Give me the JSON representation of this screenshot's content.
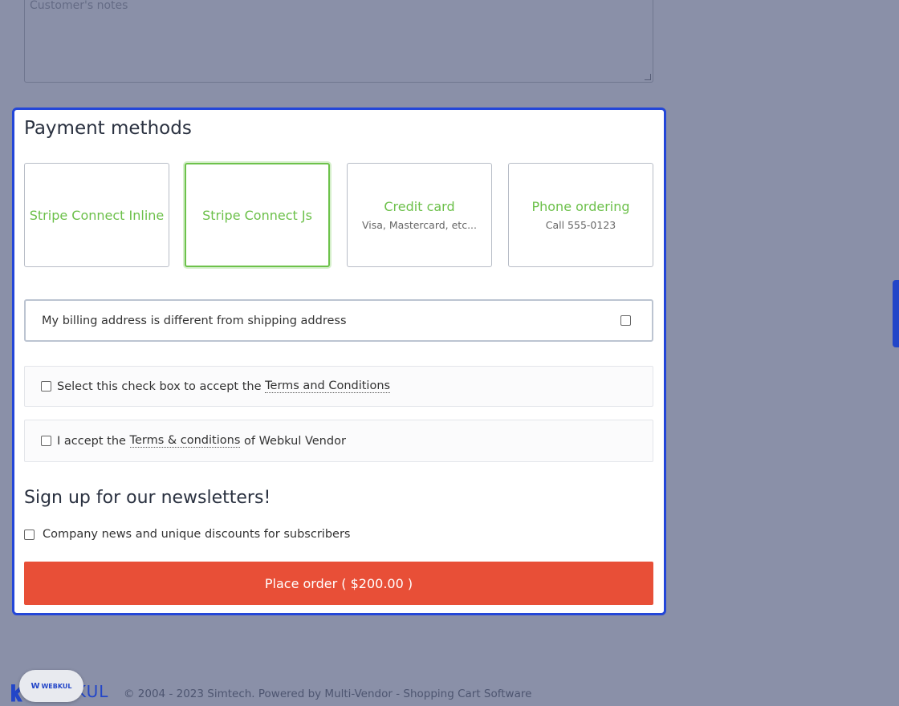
{
  "notes": {
    "placeholder": "Customer's notes"
  },
  "payment": {
    "title": "Payment methods",
    "methods": [
      {
        "name": "Stripe Connect Inline",
        "desc": ""
      },
      {
        "name": "Stripe Connect Js",
        "desc": ""
      },
      {
        "name": "Credit card",
        "desc": "Visa, Mastercard, etc..."
      },
      {
        "name": "Phone ordering",
        "desc": "Call 555-0123"
      }
    ],
    "billing_label": "My billing address is different from shipping address"
  },
  "terms": {
    "t1_prefix": "Select this check box to accept the ",
    "t1_link": "Terms and Conditions",
    "t2_prefix": "I accept the ",
    "t2_link": "Terms & conditions",
    "t2_suffix": " of Webkul Vendor"
  },
  "newsletter": {
    "title": "Sign up for our newsletters!",
    "option": "Company news and unique discounts for subscribers"
  },
  "order": {
    "button_label": "Place order ( $200.00 )"
  },
  "footer": {
    "logo_text": "KUL",
    "copyright": "© 2004 - 2023 Simtech.  Powered by Multi-Vendor - Shopping Cart Software",
    "badge_text": "WEBKUL"
  },
  "colors": {
    "accent": "#2346d8",
    "method_text": "#6cc04a",
    "order_button": "#e84f37",
    "background": "#8a90a8"
  }
}
